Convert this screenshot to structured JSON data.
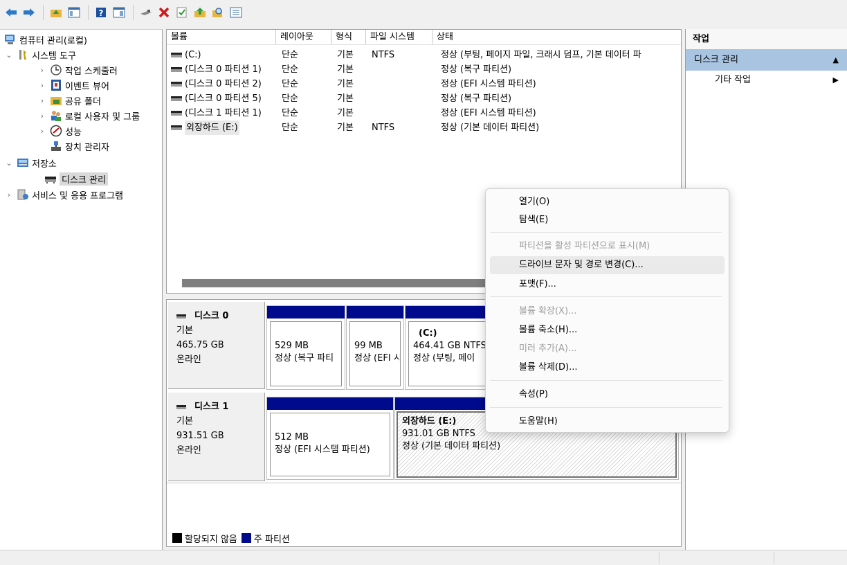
{
  "toolbar": {
    "buttons": [
      "back-icon",
      "forward-icon",
      "up-folder-icon",
      "show-hide-tree-icon",
      "help-icon",
      "properties-icon",
      "connect-icon",
      "delete-icon",
      "check-icon",
      "import-icon",
      "search-icon",
      "list-icon"
    ]
  },
  "tree": {
    "root": "컴퓨터 관리(로컬)",
    "system_tools": "시스템 도구",
    "task_scheduler": "작업 스케줄러",
    "event_viewer": "이벤트 뷰어",
    "shared_folders": "공유 폴더",
    "local_users": "로컬 사용자 및 그룹",
    "performance": "성능",
    "device_manager": "장치 관리자",
    "storage": "저장소",
    "disk_management": "디스크 관리",
    "services": "서비스 및 응용 프로그램"
  },
  "volumes": {
    "headers": [
      "볼륨",
      "레이아웃",
      "형식",
      "파일 시스템",
      "상태"
    ],
    "rows": [
      {
        "name": "(C:)",
        "layout": "단순",
        "type": "기본",
        "fs": "NTFS",
        "status": "정상 (부팅, 페이지 파일, 크래시 덤프, 기본 데이터 파"
      },
      {
        "name": "(디스크 0 파티션 1)",
        "layout": "단순",
        "type": "기본",
        "fs": "",
        "status": "정상 (복구 파티션)"
      },
      {
        "name": "(디스크 0 파티션 2)",
        "layout": "단순",
        "type": "기본",
        "fs": "",
        "status": "정상 (EFI 시스템 파티션)"
      },
      {
        "name": "(디스크 0 파티션 5)",
        "layout": "단순",
        "type": "기본",
        "fs": "",
        "status": "정상 (복구 파티션)"
      },
      {
        "name": "(디스크 1 파티션 1)",
        "layout": "단순",
        "type": "기본",
        "fs": "",
        "status": "정상 (EFI 시스템 파티션)"
      },
      {
        "name": "외장하드 (E:)",
        "layout": "단순",
        "type": "기본",
        "fs": "NTFS",
        "status": "정상 (기본 데이터 파티션)"
      }
    ]
  },
  "disks": [
    {
      "name": "디스크 0",
      "type": "기본",
      "size": "465.75 GB",
      "state": "온라인",
      "partitions": [
        {
          "title": "",
          "size": "529 MB",
          "status": "정상 (복구 파티"
        },
        {
          "title": "",
          "size": "99 MB",
          "status": "정상 (EFI 시"
        },
        {
          "title": "(C:)",
          "size": "464.41 GB NTFS",
          "status": "정상 (부팅, 페이"
        }
      ]
    },
    {
      "name": "디스크 1",
      "type": "기본",
      "size": "931.51 GB",
      "state": "온라인",
      "partitions": [
        {
          "title": "",
          "size": "512 MB",
          "status": "정상 (EFI 시스템 파티션)"
        },
        {
          "title": "외장하드  (E:)",
          "size": "931.01 GB NTFS",
          "status": "정상 (기본 데이터 파티션)"
        }
      ]
    }
  ],
  "legend": {
    "unallocated": "할당되지 않음",
    "primary": "주 파티션",
    "unallocated_color": "#000000",
    "primary_color": "#000a8c"
  },
  "actions": {
    "title": "작업",
    "section": "디스크 관리",
    "more": "기타 작업"
  },
  "context_menu": {
    "open": "열기(O)",
    "explore": "탐색(E)",
    "mark_active": "파티션을 활성 파티션으로 표시(M)",
    "change_letter": "드라이브 문자 및 경로 변경(C)...",
    "format": "포맷(F)...",
    "extend": "볼륨 확장(X)...",
    "shrink": "볼륨 축소(H)...",
    "add_mirror": "미러 추가(A)...",
    "delete": "볼륨 삭제(D)...",
    "properties": "속성(P)",
    "help": "도움말(H)"
  }
}
